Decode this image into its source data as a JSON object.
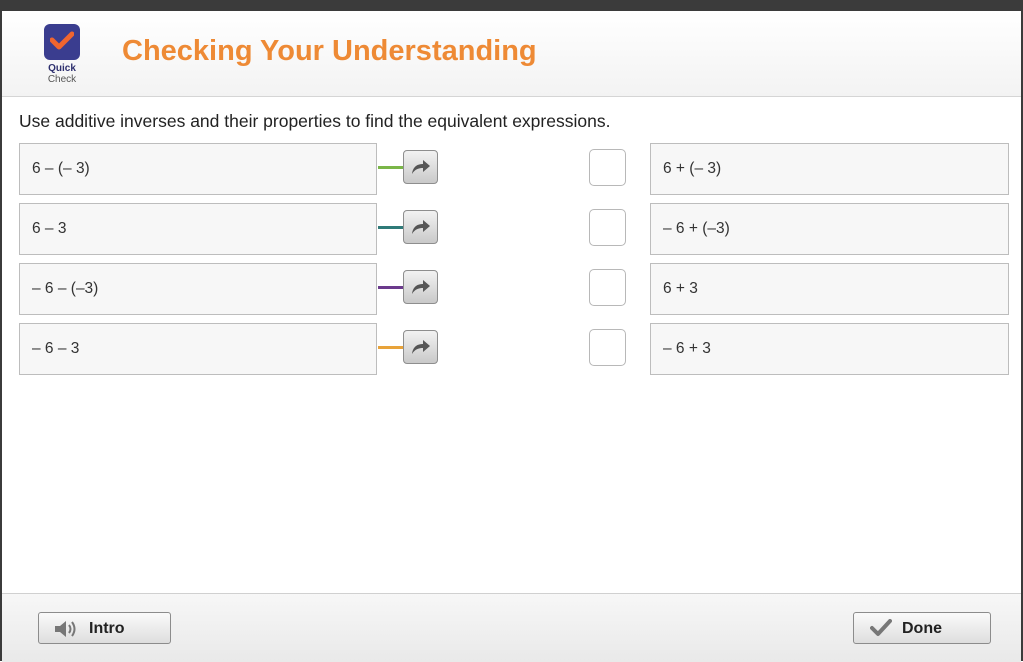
{
  "header": {
    "logo_line1": "Quick",
    "logo_line2": "Check",
    "title": "Checking Your Understanding"
  },
  "instructions": "Use additive inverses and their properties to find the equivalent expressions.",
  "left_items": [
    {
      "label": "6 – (– 3)",
      "connector_color": "#7ab648"
    },
    {
      "label": "6 – 3",
      "connector_color": "#2f7a78"
    },
    {
      "label": "– 6 – (–3)",
      "connector_color": "#6b3a8c"
    },
    {
      "label": "– 6 – 3",
      "connector_color": "#e8a33a"
    }
  ],
  "right_items": [
    {
      "label": "6 + (– 3)"
    },
    {
      "label": "– 6 + (–3)"
    },
    {
      "label": "6 + 3"
    },
    {
      "label": "– 6 + 3"
    }
  ],
  "footer": {
    "intro_label": "Intro",
    "intro_icon": "speaker-icon",
    "done_label": "Done",
    "done_icon": "checkmark-icon"
  }
}
